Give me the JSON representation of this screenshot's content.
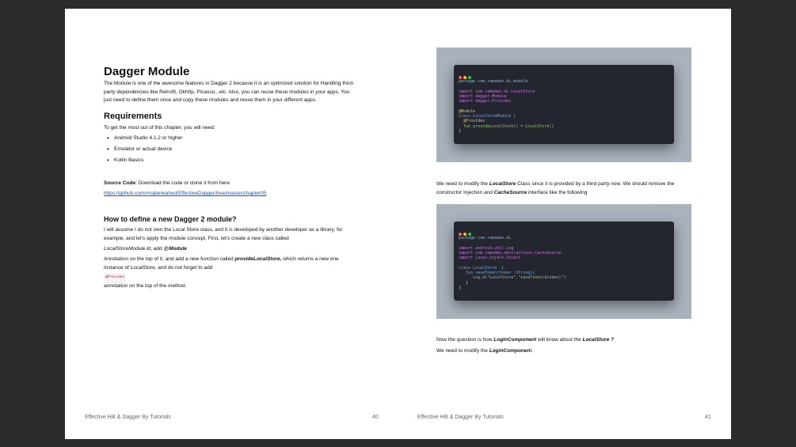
{
  "left": {
    "title": "Dagger Module",
    "intro": "The Module is one of the awesome features in Dagger 2 because it is an optimized solution for Handling third-party dependencies like Retrofit, Okhttp, Picasso,..etc. Also, you can reuse these modules in your apps. You just need to define them once and copy these modules and reuse them in your different apps.",
    "requirements_heading": "Requirements",
    "requirements_intro": "To get the most out of this chapter, you will need:",
    "requirements": [
      "Android Studio 4.1.2 or higher",
      "Emulator or actual device",
      "Kotlin Basics"
    ],
    "source_label": "Source Code",
    "source_text": ": Download the code or clone it from here",
    "source_link": "https://github.com/mrabelwahed/EffectiveDagger/tree/master/chapter05",
    "how_heading": "How to define a new Dagger 2 module?",
    "how_p1": "I will assume I do not own the Local Store class, and it is developed by another developer as a library, for example, and let's apply the module concept. First, let's create a new class called",
    "how_file": "LocalStoreModule.kt",
    "how_add": ", add @",
    "how_module": "Module",
    "how_p2a": "Annotation on the top of it, and add a new function called ",
    "how_fn": "provideLocalStore,",
    "how_p2b": " which returns a new one Instance of LocalStore, and do not forget to add",
    "provides_chip": "@Provides",
    "how_p3": "annotation on the top of the method.",
    "footer_title": "Effective Hilt & Dagger By Tutorials",
    "page_number": "40"
  },
  "right": {
    "p1a": "We need to modify the ",
    "p1b": "LocalStore",
    "p1c": " Class since it is provided by a third party now. We should remove the constructor Injection and ",
    "p1d": "CacheSource",
    "p1e": " interface like the following",
    "p2a": "Now the question is how ",
    "p2b": "LoginComponent",
    "p2c": " will know about the ",
    "p2d": "LocalStore ?",
    "p3a": "We need to modify the ",
    "p3b": "LoginComponen",
    "p3c": "t.",
    "footer_title": "Effective Hilt & Dagger By Tutorials",
    "page_number": "41"
  },
  "code1": {
    "package": "package com.ramadan.di.module",
    "import1": "import com.ramadan.di.LocalStore",
    "import2": "import dagger.Module",
    "import3": "import dagger.Provides",
    "annotation": "@Module",
    "class_line": "class LocalStoreModule {",
    "provides": "@Provides",
    "fun_line": "fun provideLocalStore() = LocalStore()",
    "close": "}"
  },
  "code2": {
    "package": "package com.ramadan.di",
    "import1": "import android.util.Log",
    "import2": "import com.ramadan.abstractions.CacheSource",
    "import3": "import javax.inject.Inject",
    "class_line": "class LocalStore  {",
    "fun_line": "fun saveToken(token :String){",
    "log_line": "Log.d(\"LocalStore\",\"saveToken($token)\")",
    "close_inner": "}",
    "close": "}"
  },
  "colors": {
    "dot_red": "#ff5f56",
    "dot_yellow": "#ffbd2e",
    "dot_green": "#27c93f",
    "link": "#1a56b8"
  }
}
